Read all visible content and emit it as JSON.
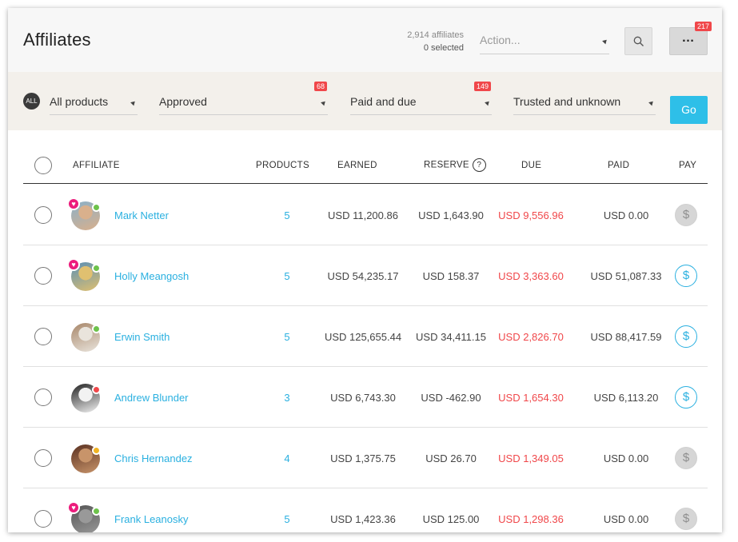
{
  "header": {
    "title": "Affiliates",
    "affiliate_count": "2,914 affiliates",
    "selected_count": "0 selected",
    "action_placeholder": "Action...",
    "more_label": "…",
    "more_badge": "217"
  },
  "filters": {
    "all_label": "ALL",
    "products": "All products",
    "status": "Approved",
    "status_badge": "68",
    "payment": "Paid and due",
    "payment_badge": "149",
    "trust": "Trusted and unknown",
    "go_label": "Go"
  },
  "table": {
    "columns": {
      "affiliate": "AFFILIATE",
      "products": "PRODUCTS",
      "earned": "EARNED",
      "reserve": "RESERVE",
      "reserve_help": "?",
      "due": "DUE",
      "paid": "PAID",
      "pay": "PAY"
    },
    "rows": [
      {
        "name": "Mark Netter",
        "products": "5",
        "earned": "USD 11,200.86",
        "reserve": "USD 1,643.90",
        "due": "USD 9,556.96",
        "paid": "USD 0.00",
        "pay_symbol": "$",
        "pay_enabled": false,
        "heart": "♥",
        "status_color": "#6dc24b",
        "avatar_colors": [
          "#8ab0c8",
          "#d9b08c"
        ]
      },
      {
        "name": "Holly Meangosh",
        "products": "5",
        "earned": "USD 54,235.17",
        "reserve": "USD 158.37",
        "due": "USD 3,363.60",
        "paid": "USD 51,087.33",
        "pay_symbol": "$",
        "pay_enabled": true,
        "heart": "♥",
        "status_color": "#6dc24b",
        "avatar_colors": [
          "#5a8fb5",
          "#e0c070"
        ]
      },
      {
        "name": "Erwin Smith",
        "products": "5",
        "earned": "USD 125,655.44",
        "reserve": "USD 34,411.15",
        "due": "USD 2,826.70",
        "paid": "USD 88,417.59",
        "pay_symbol": "$",
        "pay_enabled": true,
        "heart": "",
        "status_color": "#6dc24b",
        "avatar_colors": [
          "#a8876a",
          "#e9e4dc"
        ]
      },
      {
        "name": "Andrew Blunder",
        "products": "3",
        "earned": "USD 6,743.30",
        "reserve": "USD -462.90",
        "due": "USD 1,654.30",
        "paid": "USD 6,113.20",
        "pay_symbol": "$",
        "pay_enabled": true,
        "heart": "",
        "status_color": "#f0474a",
        "avatar_colors": [
          "#222222",
          "#f2f2f2"
        ]
      },
      {
        "name": "Chris Hernandez",
        "products": "4",
        "earned": "USD 1,375.75",
        "reserve": "USD 26.70",
        "due": "USD 1,349.05",
        "paid": "USD 0.00",
        "pay_symbol": "$",
        "pay_enabled": false,
        "heart": "",
        "status_color": "#f0b323",
        "avatar_colors": [
          "#5a3020",
          "#c8946a"
        ]
      },
      {
        "name": "Frank Leanosky",
        "products": "5",
        "earned": "USD 1,423.36",
        "reserve": "USD 125.00",
        "due": "USD 1,298.36",
        "paid": "USD 0.00",
        "pay_symbol": "$",
        "pay_enabled": false,
        "heart": "♥",
        "status_color": "#6dc24b",
        "avatar_colors": [
          "#555555",
          "#999999"
        ]
      }
    ]
  },
  "colors": {
    "accent": "#2ebfe8",
    "link": "#2ab0e0",
    "due_red": "#f0474a",
    "badge_red": "#f0474a"
  }
}
